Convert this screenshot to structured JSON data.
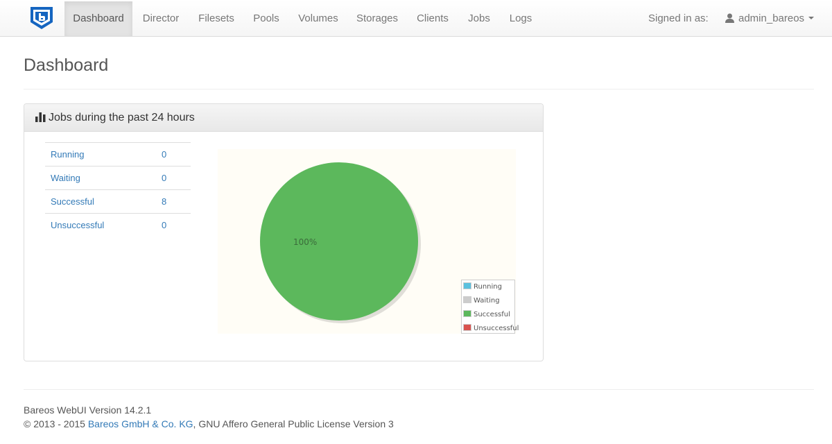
{
  "nav": {
    "items": [
      {
        "label": "Dashboard",
        "active": true
      },
      {
        "label": "Director"
      },
      {
        "label": "Filesets"
      },
      {
        "label": "Pools"
      },
      {
        "label": "Volumes"
      },
      {
        "label": "Storages"
      },
      {
        "label": "Clients"
      },
      {
        "label": "Jobs"
      },
      {
        "label": "Logs"
      }
    ],
    "signed_in_label": "Signed in as:",
    "username": "admin_bareos",
    "brand_color": "#1565c0"
  },
  "page": {
    "title": "Dashboard"
  },
  "panel": {
    "title": "Jobs during the past 24 hours",
    "rows": [
      {
        "label": "Running",
        "value": "0"
      },
      {
        "label": "Waiting",
        "value": "0"
      },
      {
        "label": "Successful",
        "value": "8"
      },
      {
        "label": "Unsuccessful",
        "value": "0"
      }
    ]
  },
  "chart_data": {
    "type": "pie",
    "categories": [
      "Running",
      "Waiting",
      "Successful",
      "Unsuccessful"
    ],
    "values": [
      0,
      0,
      8,
      0
    ],
    "colors": [
      "#5bc0de",
      "#cccccc",
      "#5cb85c",
      "#d9534f"
    ],
    "slice_labels": [
      "",
      "",
      "100%",
      ""
    ],
    "legend": "bottom-right"
  },
  "footer": {
    "version": "Bareos WebUI Version 14.2.1",
    "copyright_prefix": "© 2013 - 2015",
    "company": "Bareos GmbH & Co. KG",
    "license": ", GNU Affero General Public License Version 3"
  }
}
